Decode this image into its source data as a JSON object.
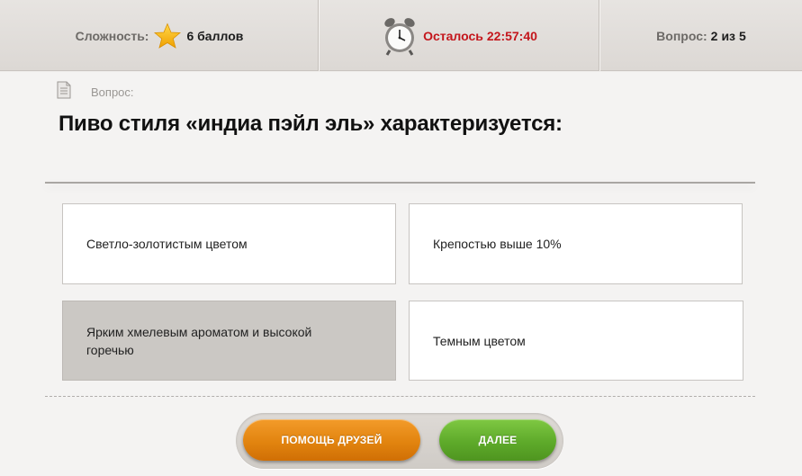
{
  "header": {
    "difficulty_label": "Сложность:",
    "difficulty_value": "6 баллов",
    "timer_label": "Осталось",
    "timer_value": "22:57:40",
    "question_label": "Вопрос:",
    "question_current": "2",
    "question_of": "из",
    "question_total": "5"
  },
  "question": {
    "label": "Вопрос:",
    "text": "Пиво стиля «индиа пэйл эль» характеризуется:"
  },
  "answers": [
    {
      "text": "Светло-золотистым цветом",
      "selected": false
    },
    {
      "text": "Крепостью выше 10%",
      "selected": false
    },
    {
      "text": "Ярким хмелевым ароматом и высокой горечью",
      "selected": true
    },
    {
      "text": "Темным цветом",
      "selected": false
    }
  ],
  "buttons": {
    "help_label": "ПОМОЩЬ ДРУЗЕЙ",
    "next_label": "ДАЛЕЕ"
  },
  "colors": {
    "timer": "#c4161c",
    "help_button": "#e2840f",
    "next_button": "#5eaa2a",
    "selected_answer": "#cbc8c4"
  },
  "icons": [
    "star-icon",
    "alarm-clock-icon",
    "document-icon"
  ]
}
